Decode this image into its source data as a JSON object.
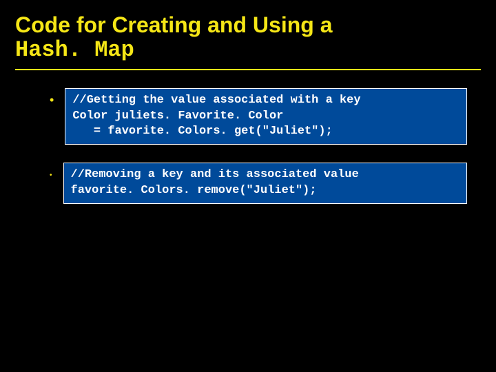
{
  "title": {
    "line1": "Code for Creating and Using a",
    "line2": "Hash. Map"
  },
  "blocks": [
    {
      "code": "//Getting the value associated with a key\nColor juliets. Favorite. Color\n   = favorite. Colors. get(\"Juliet\");"
    },
    {
      "code": "//Removing a key and its associated value\nfavorite. Colors. remove(\"Juliet\");"
    }
  ]
}
